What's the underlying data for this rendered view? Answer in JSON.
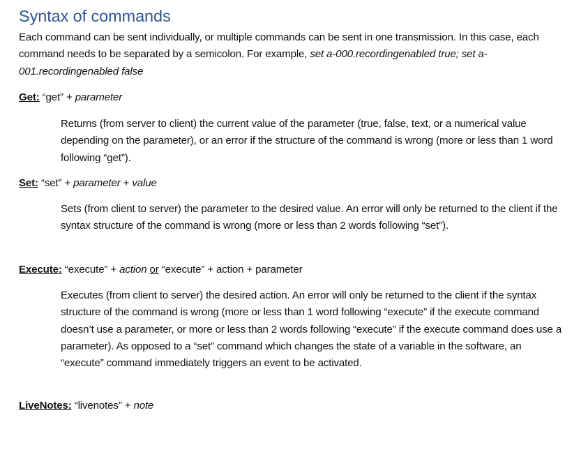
{
  "heading": "Syntax of commands",
  "intro": {
    "text": "Each command can be sent individually, or multiple commands can be sent in one transmission. In this case, each command needs to be separated by a semicolon. For example, ",
    "example": "set a-000.recordingenabled true; set a-001.recordingenabled false"
  },
  "get": {
    "label": "Get:",
    "syntax_quote": " “get” + ",
    "syntax_param": "parameter",
    "description": "Returns (from server to client) the current value of the parameter (true, false, text, or a numerical value depending on the parameter), or an error if the structure of the command is wrong (more or less than 1 word following “get”)."
  },
  "set": {
    "label": "Set:",
    "syntax_quote": " “set” + ",
    "syntax_param": "parameter",
    "syntax_plus": " + ",
    "syntax_value": "value",
    "description": "Sets (from client to server) the parameter to the desired value. An error will only be returned to the client if the syntax structure of the command is wrong (more or less than 2 words following “set”)."
  },
  "execute": {
    "label": "Execute:",
    "syntax_quote": " “execute” + ",
    "syntax_action": "action",
    "syntax_or": "or",
    "syntax_rest": " “execute” + action + parameter",
    "description": "Executes (from client to server) the desired action. An error will only be returned to the client if the syntax structure of the command is wrong (more or less than 1 word following “execute” if the execute command doesn’t use a parameter, or more or less than 2 words following “execute” if the execute command does use a parameter). As opposed to a “set” command which changes the state of a variable in the software, an “execute” command immediately triggers an event to be activated."
  },
  "livenotes": {
    "label": "LiveNotes:",
    "syntax_quote": " “livenotes” + ",
    "syntax_note": "note"
  },
  "colors": {
    "heading": "#2f5496",
    "text": "#111111"
  }
}
